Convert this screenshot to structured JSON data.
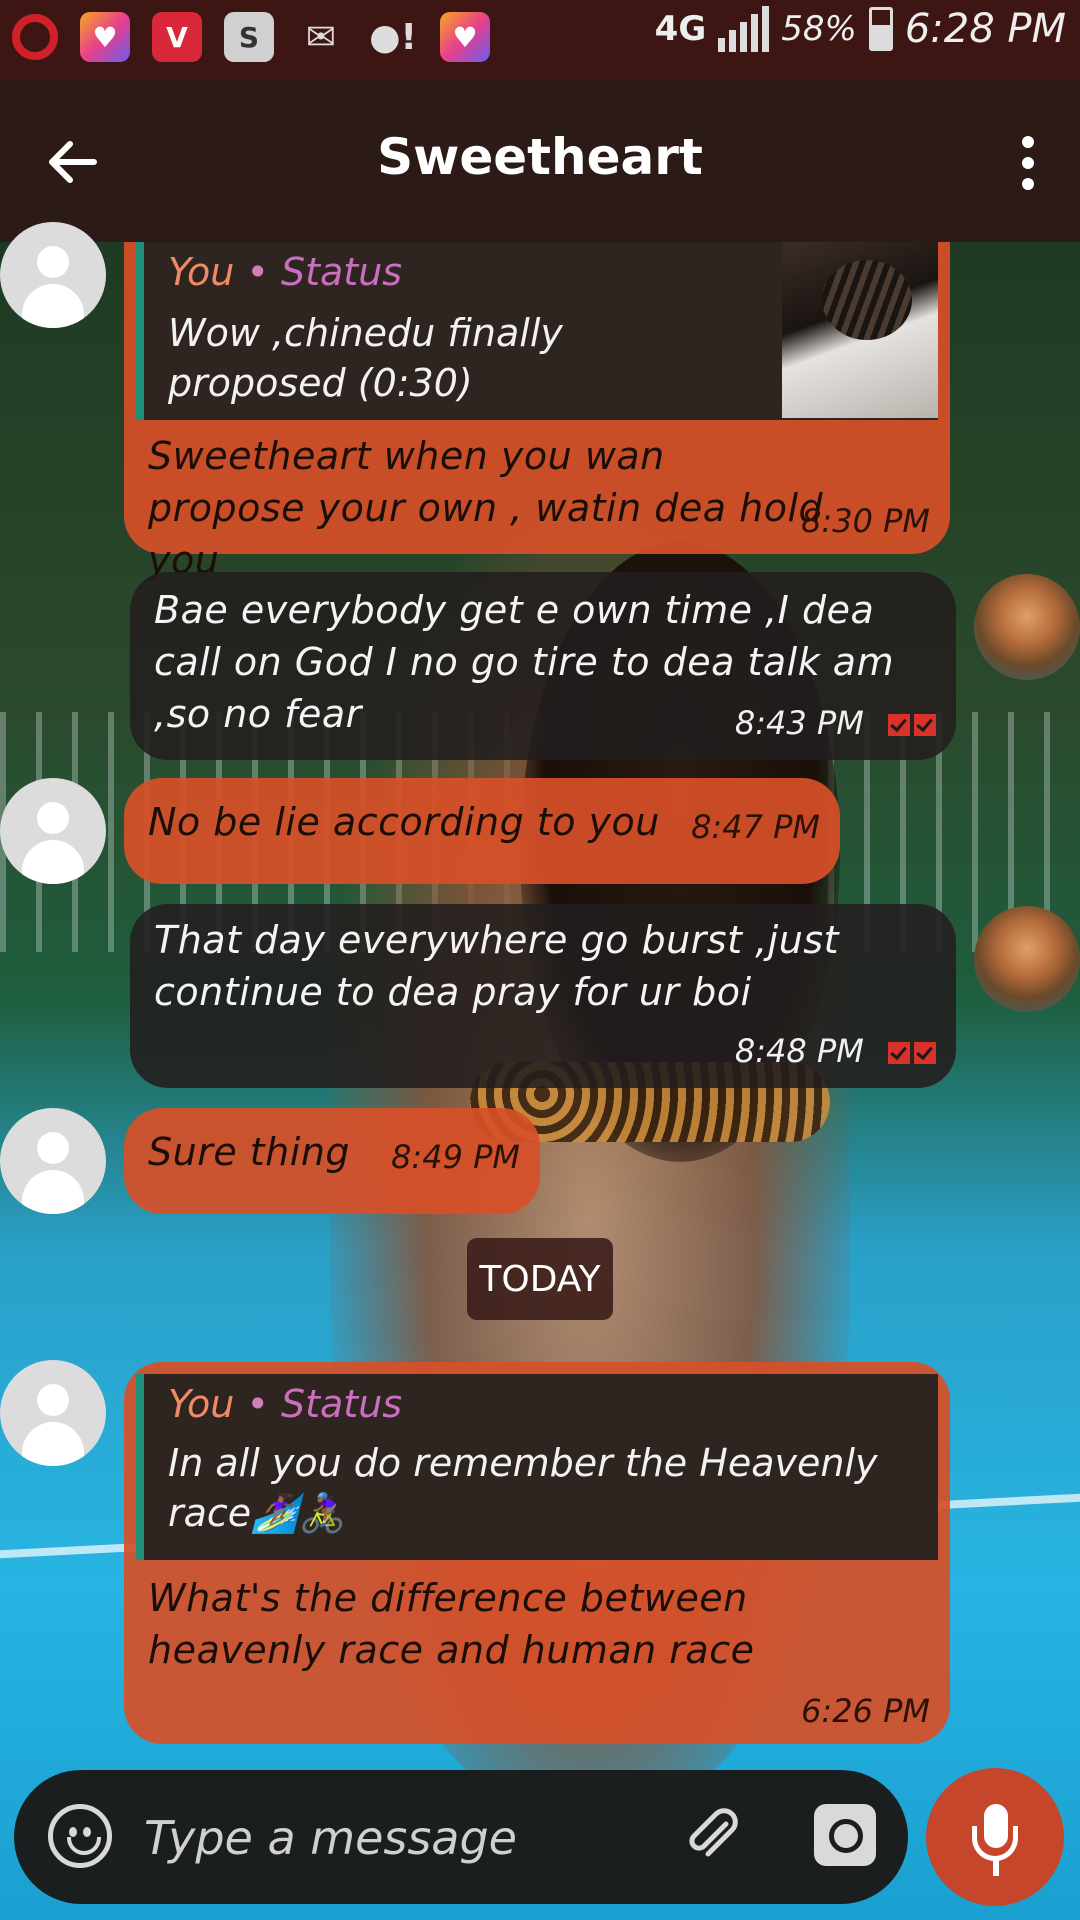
{
  "status_bar": {
    "network": "4G",
    "battery": "58%",
    "time": "6:28 PM",
    "notification_icons": [
      "opera-mini-icon",
      "likee-icon",
      "v-app-icon",
      "s-app-icon",
      "mail-icon",
      "alert-icon",
      "likee-icon"
    ]
  },
  "header": {
    "title": "Sweetheart"
  },
  "messages": [
    {
      "direction": "incoming",
      "quote": {
        "author": "You",
        "separator": "•",
        "source": "Status",
        "text": "Wow ,chinedu finally proposed (0:30)"
      },
      "text": "Sweetheart when you wan propose your own , watin dea hold you",
      "time": "8:30 PM"
    },
    {
      "direction": "outgoing",
      "text": "Bae everybody get e own time ,I dea call on God I no go tire to dea talk am ,so no fear",
      "time": "8:43 PM"
    },
    {
      "direction": "incoming",
      "text": "No be lie according to you",
      "time": "8:47 PM"
    },
    {
      "direction": "outgoing",
      "text": "That day everywhere go burst ,just continue to dea pray for ur boi",
      "time": "8:48 PM"
    },
    {
      "direction": "incoming",
      "text": "Sure thing",
      "time": "8:49 PM"
    },
    {
      "direction": "incoming",
      "quote": {
        "author": "You",
        "separator": "•",
        "source": "Status",
        "text": "In all you do remember the Heavenly race🏄🏾‍♀️🚴🏾‍♀️"
      },
      "text": "What's the difference between heavenly race and human race",
      "time": "6:26 PM"
    }
  ],
  "date_divider": "TODAY",
  "composer": {
    "placeholder": "Type a message"
  },
  "colors": {
    "incoming_bubble": "#d65028",
    "outgoing_bubble": "#221e1e",
    "header": "#2c1a16",
    "status_bar": "#3d1613",
    "accent_quote_bar": "#1f8f7a",
    "mic_button": "#c5462b"
  }
}
